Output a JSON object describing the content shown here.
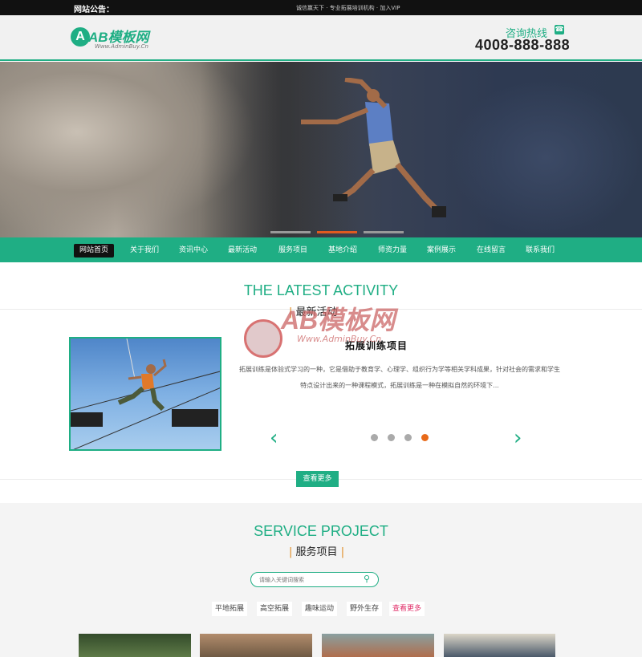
{
  "topbar": {
    "label": "网站公告：",
    "notice": "诚信赢天下 · 专业拓展培训机构 · 加入VIP"
  },
  "header": {
    "logo_mark": "A",
    "logo_text": "AB模板网",
    "logo_sub": "Www.AdminBuy.Cn",
    "hotline_label": "咨询热线",
    "phone": "4008-888-888"
  },
  "nav": {
    "items": [
      "网站首页",
      "关于我们",
      "资讯中心",
      "最新活动",
      "服务项目",
      "基地介绍",
      "师资力量",
      "案例展示",
      "在线留言",
      "联系我们"
    ],
    "active_index": 0
  },
  "banner": {
    "slide_count": 3,
    "active_slide": 2
  },
  "activity": {
    "en_title": "THE LATEST ACTIVITY",
    "cn_title": "最新活动",
    "item_title": "拓展训练项目",
    "description": "拓展训练是体验式学习的一种，它是借助于教育学、心理学、组织行为学等相关学科成果，针对社会的需求和学生特点设计出来的一种课程模式，拓展训练是一种在模拟自然的环境下...",
    "prev_icon": "chevron-left-icon",
    "next_icon": "chevron-right-icon",
    "pager_count": 4,
    "pager_active": 3,
    "more_label": "查看更多"
  },
  "watermark": {
    "mark": "A",
    "text": "AB模板网",
    "sub": "Www.AdminBuy.Cn"
  },
  "service": {
    "en_title": "SERVICE PROJECT",
    "cn_title": "服务项目",
    "search_placeholder": "请输入关键词搜索",
    "tags": [
      "平地拓展",
      "高空拓展",
      "趣味运动",
      "野外生存"
    ],
    "more_tag": "查看更多"
  },
  "colors": {
    "accent": "#1fae84",
    "topbar": "#111111",
    "highlight": "#e86a1a"
  }
}
